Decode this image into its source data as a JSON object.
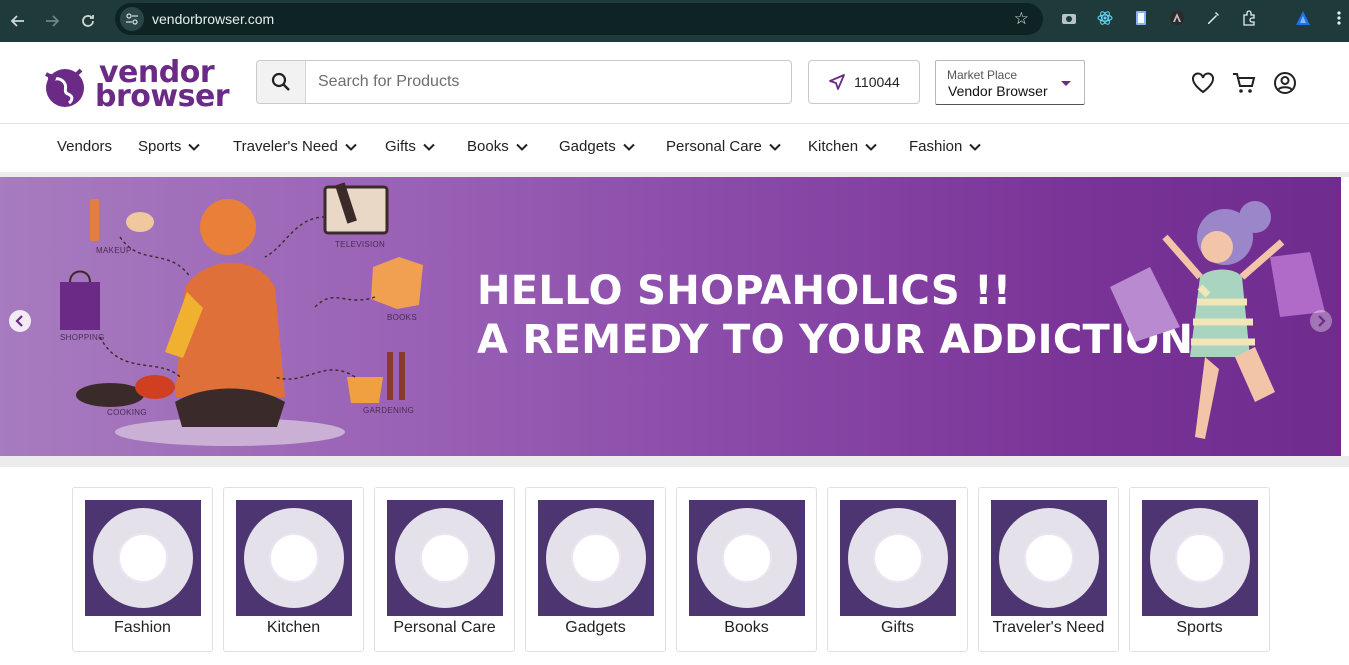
{
  "browser": {
    "url": "vendorbrowser.com",
    "back_icon": "arrow-left-icon",
    "forward_icon": "arrow-right-icon",
    "reload_icon": "reload-icon",
    "bookmark_icon": "star-icon"
  },
  "header": {
    "logo_line1": "vendor",
    "logo_line2": "browser",
    "search_placeholder": "Search for Products",
    "pincode": "110044",
    "marketplace_label": "Market Place",
    "marketplace_value": "Vendor Browser"
  },
  "nav": {
    "items": [
      {
        "label": "Vendors",
        "dropdown": false
      },
      {
        "label": "Sports",
        "dropdown": true
      },
      {
        "label": "Traveler's Need",
        "dropdown": true
      },
      {
        "label": "Gifts",
        "dropdown": true
      },
      {
        "label": "Books",
        "dropdown": true
      },
      {
        "label": "Gadgets",
        "dropdown": true
      },
      {
        "label": "Personal Care",
        "dropdown": true
      },
      {
        "label": "Kitchen",
        "dropdown": true
      },
      {
        "label": "Fashion",
        "dropdown": true
      }
    ]
  },
  "banner": {
    "line1": "HELLO SHOPAHOLICS !!",
    "line2": "A REMEDY TO YOUR ADDICTION.",
    "labels": {
      "makeup": "MAKEUP",
      "television": "TELEVISION",
      "books": "BOOKS",
      "shopping": "SHOPPING",
      "cooking": "COOKING",
      "gardening": "GARDENING"
    }
  },
  "categories": [
    {
      "label": "Fashion"
    },
    {
      "label": "Kitchen"
    },
    {
      "label": "Personal Care"
    },
    {
      "label": "Gadgets"
    },
    {
      "label": "Books"
    },
    {
      "label": "Gifts"
    },
    {
      "label": "Traveler's Need"
    },
    {
      "label": "Sports"
    }
  ],
  "colors": {
    "brand": "#6b2a86",
    "banner": "#8a4aa8",
    "chrome": "#1f3a3a"
  }
}
